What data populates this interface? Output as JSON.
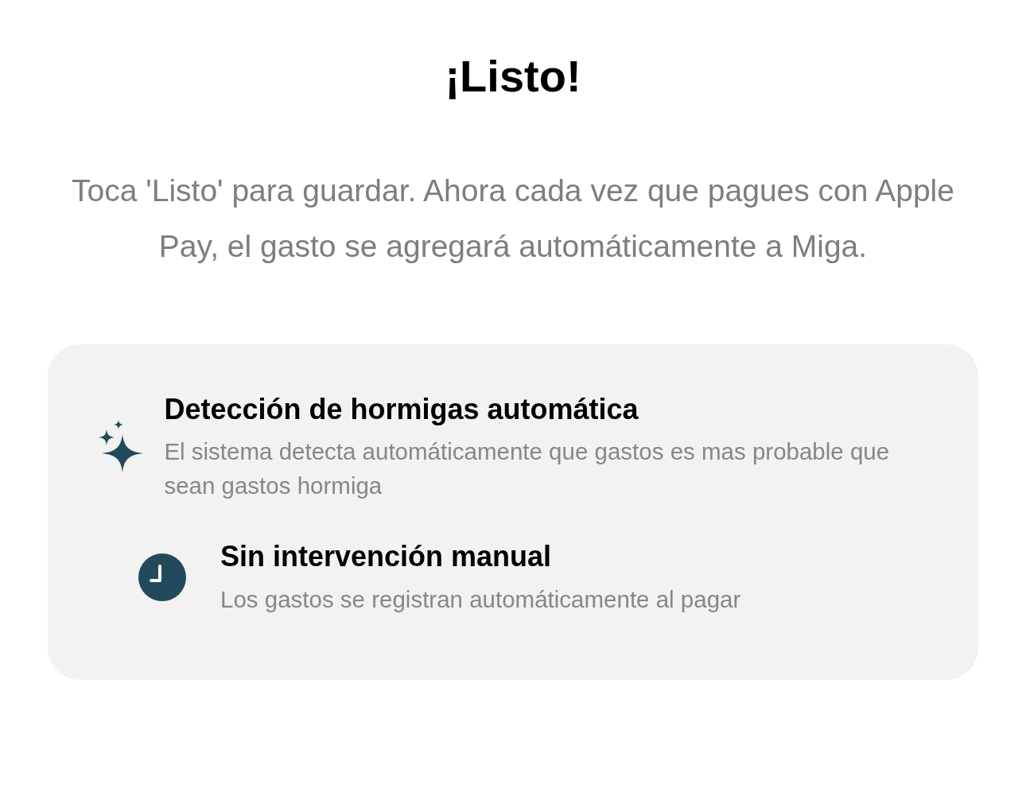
{
  "title": "¡Listo!",
  "message": "Toca 'Listo' para guardar. Ahora cada vez que pagues con Apple Pay, el gasto se agregará automáticamente a Miga.",
  "features": [
    {
      "kind": "sparkles",
      "title": "Detección de hormigas automática",
      "description": "El sistema detecta automáticamente que gastos es mas probable que sean gastos hormiga"
    },
    {
      "kind": "clock",
      "title": "Sin intervención manual",
      "description": "Los gastos se registran automáticamente al pagar"
    }
  ]
}
